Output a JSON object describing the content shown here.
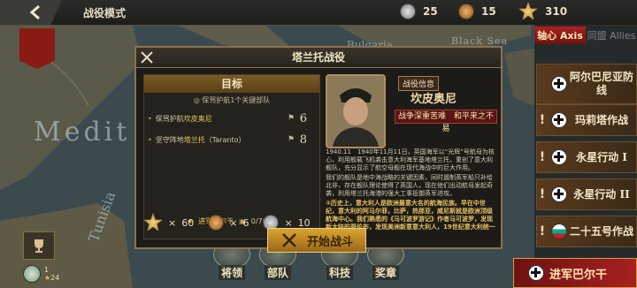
{
  "topbar": {
    "mode_title": "战役模式",
    "silver_count": "25",
    "bronze_count": "15",
    "gold_count": "310"
  },
  "map": {
    "labels": {
      "bulgaria": "Bulgaria",
      "black_sea": "Black Sea",
      "medit": "Medit",
      "tunisia": "Tunisia"
    }
  },
  "side": {
    "tab_axis": "轴心 Axis",
    "tab_allies": "同盟 Allies",
    "campaigns": [
      "阿尔巴尼亚防线",
      "玛莉塔作战",
      "永星行动 I",
      "永星行动 II",
      "二十五号作战"
    ],
    "campaign_marks": [
      "",
      "!",
      "!",
      "!",
      "!"
    ],
    "jinjun_label": "进军巴尔干"
  },
  "panel": {
    "title": "塔兰托战役",
    "objectives_header": "目标",
    "objectives_sub": "保骂护航1个关键部队",
    "objectives": [
      {
        "prefix": "保骂护航",
        "highlight": "坎皮奥尼",
        "suffix": "",
        "count": "6"
      },
      {
        "prefix": "坚守阵地",
        "highlight": "塔兰托",
        "suffix": "（Taranto）",
        "count": "8"
      }
    ],
    "progress_label": "进军巴尔干",
    "progress_value": "0/700",
    "rewards": [
      {
        "kind": "gold",
        "value": "60"
      },
      {
        "kind": "bronze",
        "value": "6"
      },
      {
        "kind": "silver",
        "value": "10"
      }
    ],
    "info_label": "战役信息",
    "general_name": "坎皮奥尼",
    "trait": "战争深重苦难　和平来之不易",
    "intro": "1940.11　1940年11月11日，英国海军以“光辉”号航母为核心，利用舰载飞机袭击意大利海军基地塔兰托，重创了意大利舰队，充分显示了航空母舰在现代海战中的巨大作用。",
    "body1": "我们的舰队是地中海战略的关键因素，同时遏制英军船只补给北非，存在舰队理论使得了英国人，现在他们出动航母发起奇袭，利用塔兰托海港的强大工事抵御英军进攻。",
    "history_lead": "①历史上，意大利人是欧洲最意大名的航海民族。早在中世纪，意大利的阿马尔菲，比萨，热那亚，威尼斯就是欧洲顶级航海中心。我们熟悉的《马可波罗游记》作者马可波罗，发现新大陆的哥伦布，发现美洲新意意大利人，19世纪意大利统一以",
    "start_label": "开始战斗"
  },
  "bottom_nav": [
    "将领",
    "部队",
    "科技",
    "奖章"
  ],
  "player": {
    "level": "1",
    "stars": "24"
  }
}
